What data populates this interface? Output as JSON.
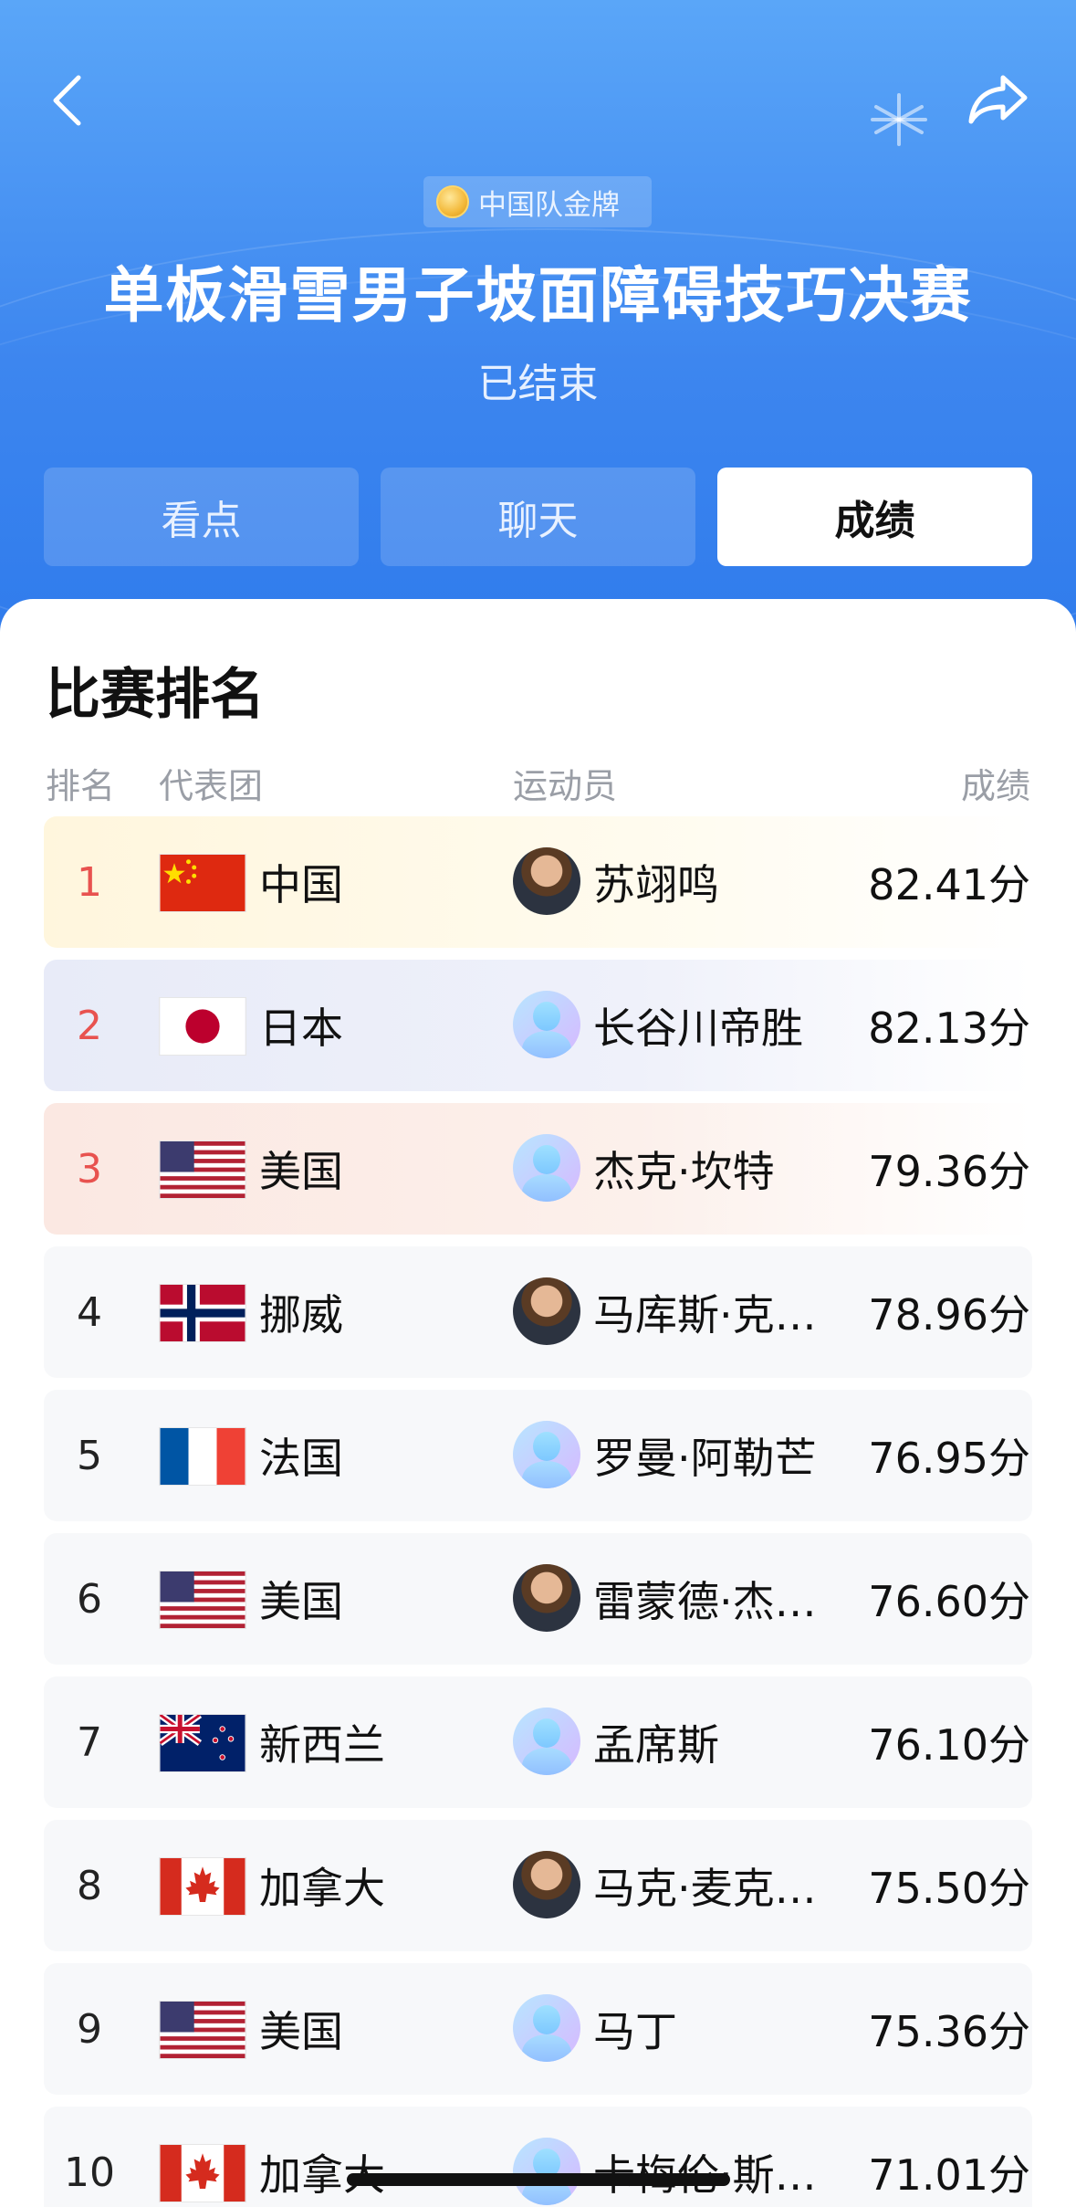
{
  "header": {
    "badge": "中国队金牌",
    "title": "单板滑雪男子坡面障碍技巧决赛",
    "status": "已结束"
  },
  "tabs": [
    {
      "label": "看点",
      "active": false
    },
    {
      "label": "聊天",
      "active": false
    },
    {
      "label": "成绩",
      "active": true
    }
  ],
  "ranking": {
    "title": "比赛排名",
    "columns": {
      "rank": "排名",
      "team": "代表团",
      "athlete": "运动员",
      "score": "成绩"
    },
    "rows": [
      {
        "rank": "1",
        "team": "中国",
        "flag": "cn-flag",
        "athlete": "苏翊鸣",
        "avatar": "photo",
        "score": "82.41分"
      },
      {
        "rank": "2",
        "team": "日本",
        "flag": "jp-flag",
        "athlete": "长谷川帝胜",
        "avatar": "placeholder",
        "score": "82.13分"
      },
      {
        "rank": "3",
        "team": "美国",
        "flag": "us-flag",
        "athlete": "杰克·坎特",
        "avatar": "placeholder",
        "score": "79.36分"
      },
      {
        "rank": "4",
        "team": "挪威",
        "flag": "no-flag",
        "athlete": "马库斯·克…",
        "avatar": "photo",
        "score": "78.96分"
      },
      {
        "rank": "5",
        "team": "法国",
        "flag": "fr-flag",
        "athlete": "罗曼·阿勒芒",
        "avatar": "placeholder",
        "score": "76.95分"
      },
      {
        "rank": "6",
        "team": "美国",
        "flag": "us-flag",
        "athlete": "雷蒙德·杰…",
        "avatar": "photo",
        "score": "76.60分"
      },
      {
        "rank": "7",
        "team": "新西兰",
        "flag": "nz-flag",
        "athlete": "孟席斯",
        "avatar": "placeholder",
        "score": "76.10分"
      },
      {
        "rank": "8",
        "team": "加拿大",
        "flag": "ca-flag",
        "athlete": "马克·麦克…",
        "avatar": "photo",
        "score": "75.50分"
      },
      {
        "rank": "9",
        "team": "美国",
        "flag": "us-flag",
        "athlete": "马丁",
        "avatar": "placeholder",
        "score": "75.36分"
      },
      {
        "rank": "10",
        "team": "加拿大",
        "flag": "ca-flag",
        "athlete": "卡梅伦·斯…",
        "avatar": "placeholder",
        "score": "71.01分"
      }
    ]
  },
  "colors": {
    "header_blue": "#3d86ef",
    "rank_red": "#e8524f"
  }
}
